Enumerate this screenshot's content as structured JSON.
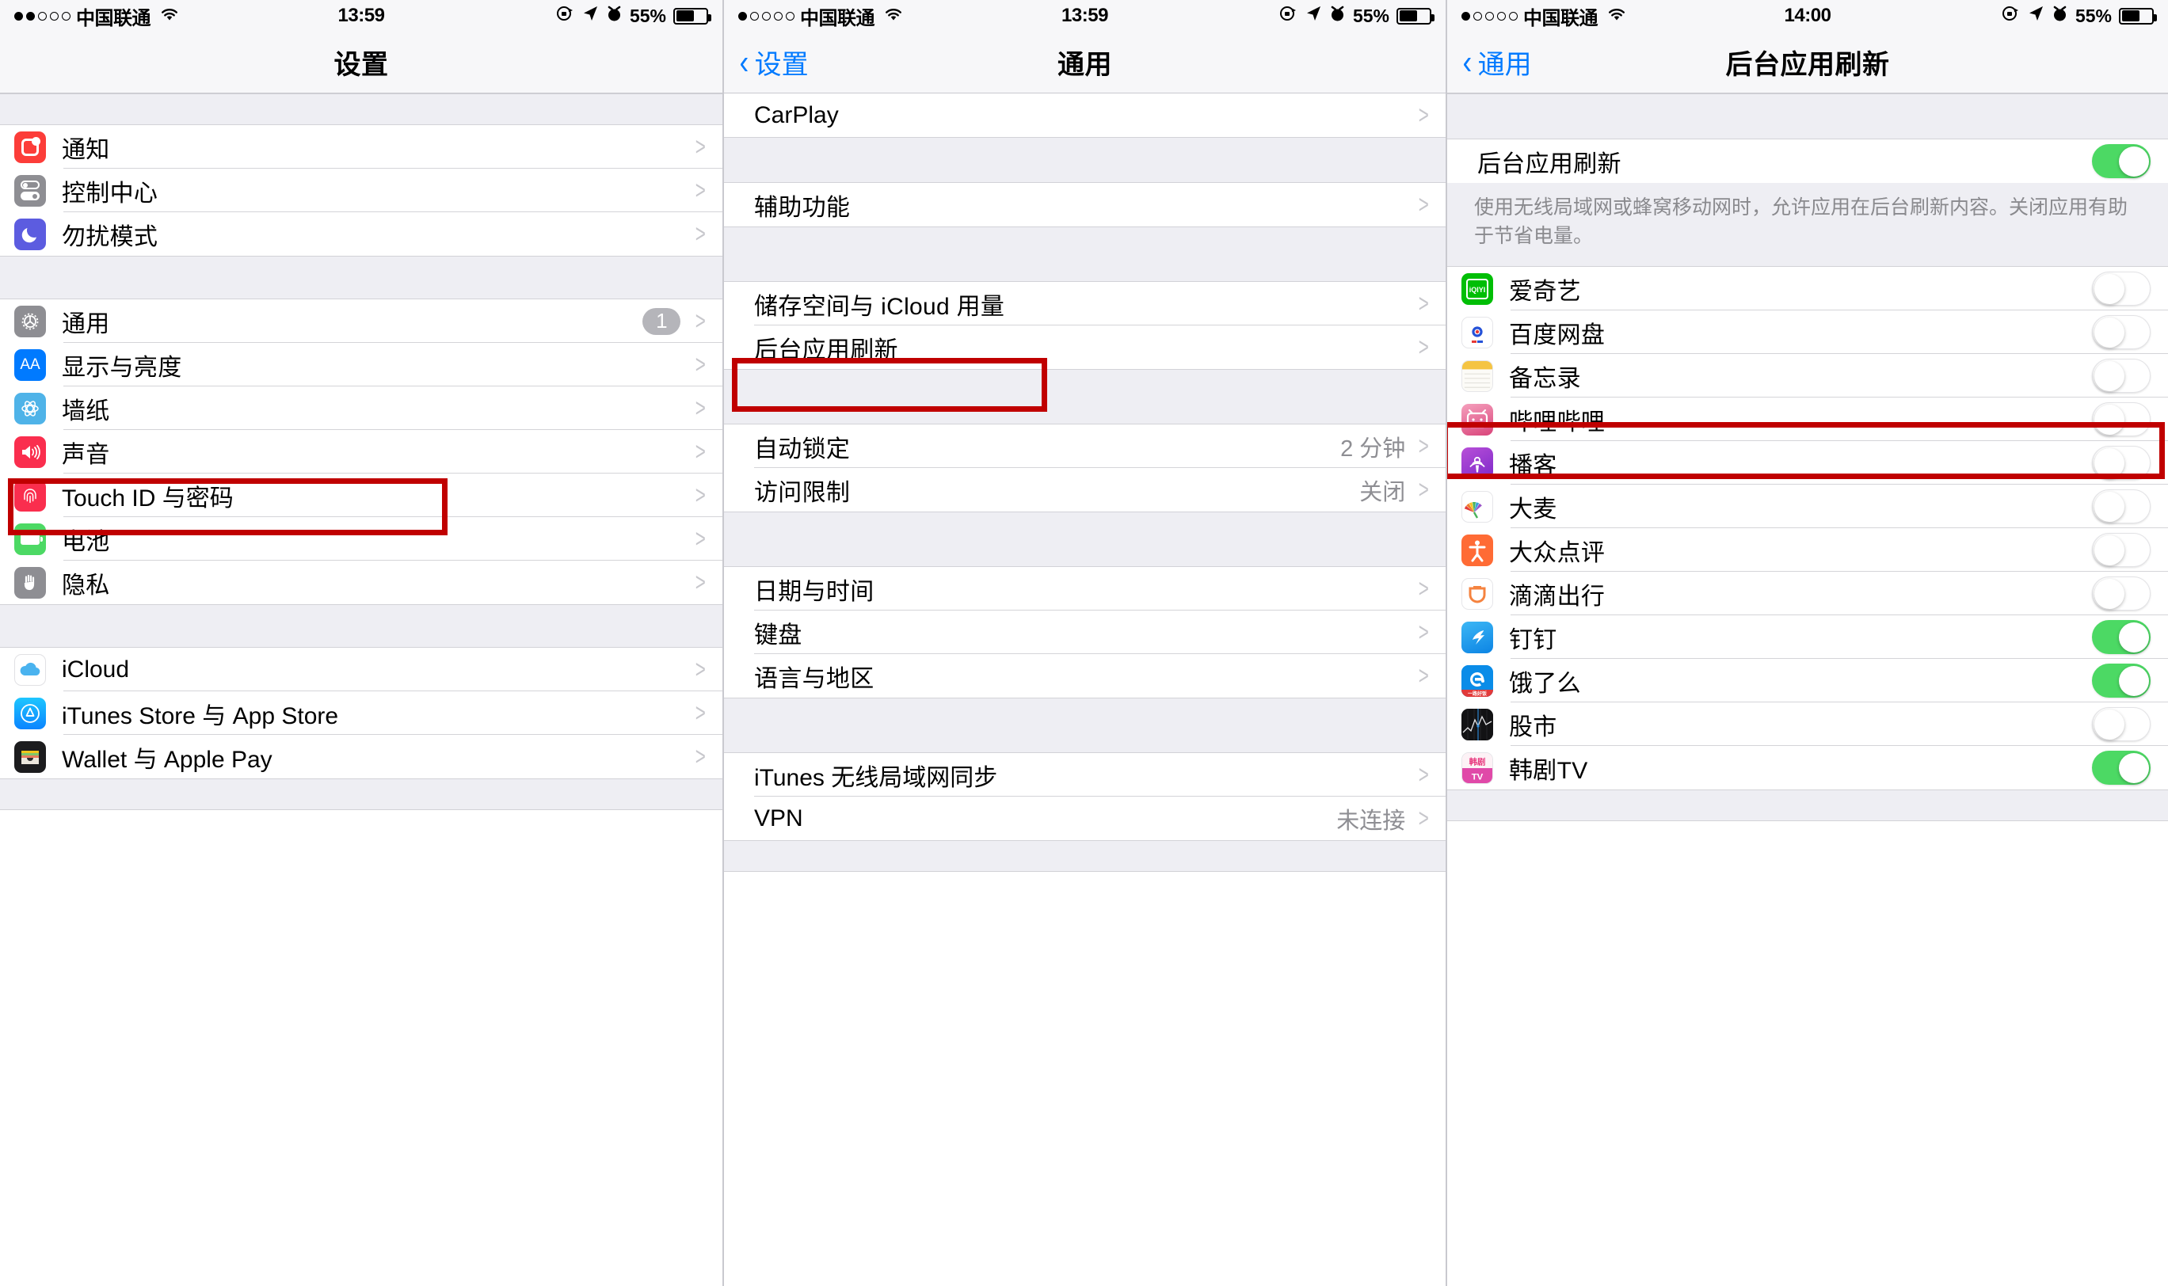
{
  "screens": [
    {
      "status": {
        "dots_filled": 2,
        "dots_total": 5,
        "carrier": "中国联通",
        "time": "13:59",
        "battery_pct": "55%"
      },
      "nav": {
        "back": "",
        "title": "设置"
      },
      "sections": [
        {
          "rows": [
            {
              "icon": "notifications-icon",
              "label": "通知",
              "chevron": ">"
            },
            {
              "icon": "control-center-icon",
              "label": "控制中心",
              "chevron": ">"
            },
            {
              "icon": "do-not-disturb-icon",
              "label": "勿扰模式",
              "chevron": ">"
            }
          ]
        },
        {
          "rows": [
            {
              "icon": "general-gear-icon",
              "label": "通用",
              "badge": "1",
              "chevron": ">",
              "highlight": true
            },
            {
              "icon": "display-brightness-icon",
              "label": "显示与亮度",
              "chevron": ">"
            },
            {
              "icon": "wallpaper-icon",
              "label": "墙纸",
              "chevron": ">"
            },
            {
              "icon": "sounds-icon",
              "label": "声音",
              "chevron": ">"
            },
            {
              "icon": "touch-id-icon",
              "label": "Touch ID 与密码",
              "chevron": ">"
            },
            {
              "icon": "battery-icon",
              "label": "电池",
              "chevron": ">"
            },
            {
              "icon": "privacy-icon",
              "label": "隐私",
              "chevron": ">"
            }
          ]
        },
        {
          "rows": [
            {
              "icon": "icloud-icon",
              "label": "iCloud",
              "chevron": ">"
            },
            {
              "icon": "itunes-appstore-icon",
              "label": "iTunes Store 与 App Store",
              "chevron": ">"
            },
            {
              "icon": "wallet-apple-pay-icon",
              "label": "Wallet 与 Apple Pay",
              "chevron": ">"
            }
          ]
        }
      ]
    },
    {
      "status": {
        "dots_filled": 1,
        "dots_total": 5,
        "carrier": "中国联通",
        "time": "13:59",
        "battery_pct": "55%"
      },
      "nav": {
        "back": "设置",
        "title": "通用"
      },
      "sections": [
        {
          "rows": [
            {
              "label": "CarPlay",
              "chevron": ">"
            }
          ]
        },
        {
          "rows": [
            {
              "label": "辅助功能",
              "chevron": ">"
            }
          ]
        },
        {
          "rows": [
            {
              "label": "储存空间与 iCloud 用量",
              "chevron": ">"
            },
            {
              "label": "后台应用刷新",
              "chevron": ">",
              "highlight": true
            }
          ]
        },
        {
          "rows": [
            {
              "label": "自动锁定",
              "value": "2 分钟",
              "chevron": ">"
            },
            {
              "label": "访问限制",
              "value": "关闭",
              "chevron": ">"
            }
          ]
        },
        {
          "rows": [
            {
              "label": "日期与时间",
              "chevron": ">"
            },
            {
              "label": "键盘",
              "chevron": ">"
            },
            {
              "label": "语言与地区",
              "chevron": ">"
            }
          ]
        },
        {
          "rows": [
            {
              "label": "iTunes 无线局域网同步",
              "chevron": ">"
            },
            {
              "label": "VPN",
              "value": "未连接",
              "chevron": ">"
            }
          ]
        }
      ]
    },
    {
      "status": {
        "dots_filled": 1,
        "dots_total": 5,
        "carrier": "中国联通",
        "time": "14:00",
        "battery_pct": "55%"
      },
      "nav": {
        "back": "通用",
        "title": "后台应用刷新"
      },
      "master": {
        "label": "后台应用刷新",
        "on": true
      },
      "description": "使用无线局域网或蜂窝移动网时，允许应用在后台刷新内容。关闭应用有助于节省电量。",
      "apps": [
        {
          "icon": "iqiyi-icon",
          "label": "爱奇艺",
          "on": false
        },
        {
          "icon": "baidu-pan-icon",
          "label": "百度网盘",
          "on": false,
          "highlight": true
        },
        {
          "icon": "notes-icon",
          "label": "备忘录",
          "on": false
        },
        {
          "icon": "bilibili-icon",
          "label": "哔哩哔哩",
          "on": false
        },
        {
          "icon": "podcasts-icon",
          "label": "播客",
          "on": false
        },
        {
          "icon": "damai-icon",
          "label": "大麦",
          "on": false
        },
        {
          "icon": "dianping-icon",
          "label": "大众点评",
          "on": false
        },
        {
          "icon": "didi-icon",
          "label": "滴滴出行",
          "on": false
        },
        {
          "icon": "dingtalk-icon",
          "label": "钉钉",
          "on": true
        },
        {
          "icon": "eleme-icon",
          "label": "饿了么",
          "on": true
        },
        {
          "icon": "stocks-icon",
          "label": "股市",
          "on": false
        },
        {
          "icon": "hanjutv-icon",
          "label": "韩剧TV",
          "on": true
        }
      ]
    }
  ]
}
